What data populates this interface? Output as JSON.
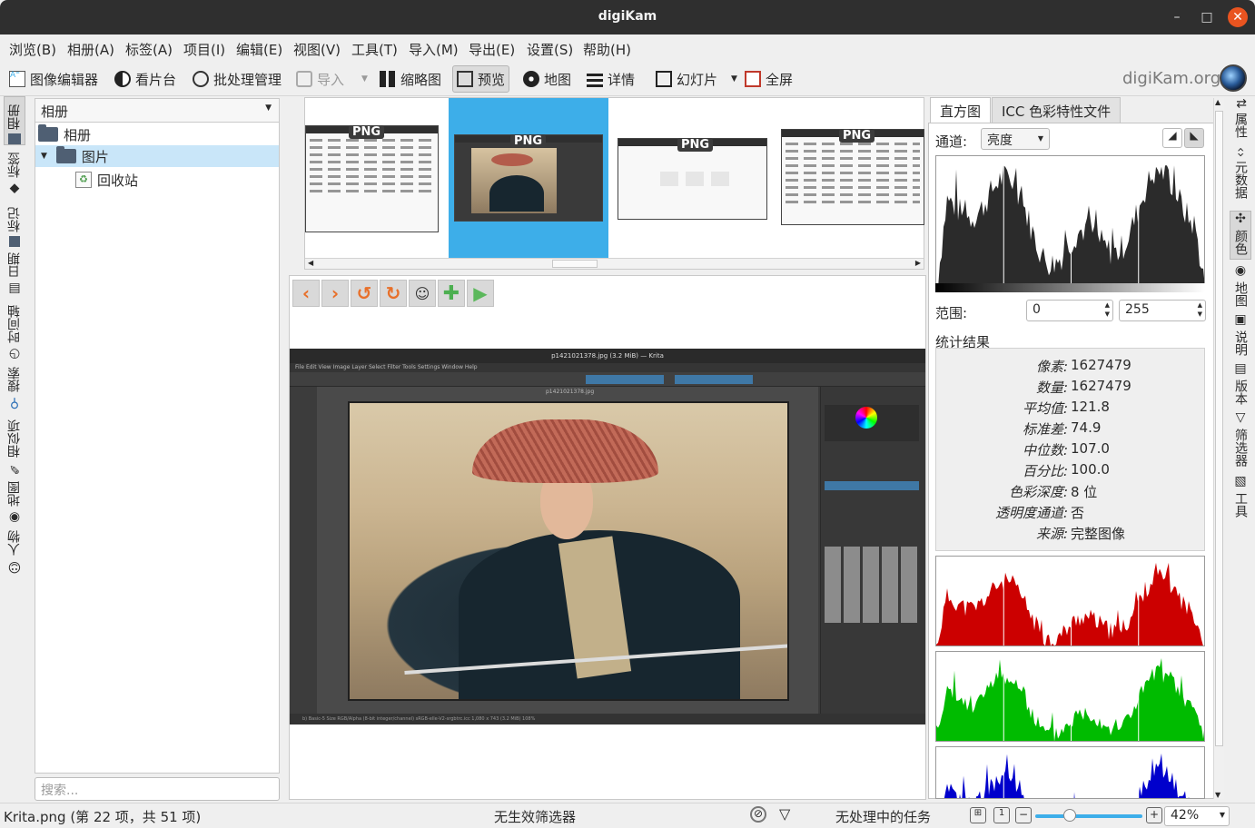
{
  "window": {
    "title": "digiKam",
    "min": "–",
    "max": "□",
    "close": "✕"
  },
  "menu": [
    "浏览(B)",
    "相册(A)",
    "标签(A)",
    "项目(I)",
    "编辑(E)",
    "视图(V)",
    "工具(T)",
    "导入(M)",
    "导出(E)",
    "设置(S)",
    "帮助(H)"
  ],
  "toolbar": {
    "image_editor": "图像编辑器",
    "light_table": "看片台",
    "batch_queue": "批处理管理",
    "import": "导入",
    "thumbnails": "缩略图",
    "preview": "预览",
    "map": "地图",
    "details": "详情",
    "slideshow": "幻灯片",
    "fullscreen": "全屏",
    "brand": "digiKam.org"
  },
  "left_tabs": [
    "相册",
    "标签",
    "标记",
    "日期",
    "时间轴",
    "搜索",
    "相似项",
    "地图",
    "人物"
  ],
  "album_panel": {
    "combo": "相册",
    "tree": [
      {
        "label": "相册",
        "level": 0
      },
      {
        "label": "图片",
        "level": 1,
        "selected": true
      },
      {
        "label": "回收站",
        "level": 2
      }
    ],
    "search_placeholder": "搜索..."
  },
  "thumbnails": [
    {
      "badge": "PNG",
      "selected": false
    },
    {
      "badge": "PNG",
      "selected": true
    },
    {
      "badge": "PNG",
      "selected": false
    },
    {
      "badge": "PNG",
      "selected": false
    }
  ],
  "preview_tools": [
    "back-icon",
    "forward-icon",
    "rotate-left-icon",
    "rotate-right-icon",
    "face-tag-icon",
    "add-to-light-table-icon",
    "play-icon"
  ],
  "krita": {
    "title": "p1421021378.jpg (3.2 MiB) — Krita",
    "menu": "File  Edit  View  Image  Layer  Select  Filter  Tools  Settings  Window  Help",
    "tab": "p1421021378.jpg",
    "status": "b) Basic-5 Size        RGB/Alpha (8-bit integer/channel)  sRGB-elle-V2-srgbtrc.icc        1,080 x 743 (3.2 MiB)        108%"
  },
  "right_panel": {
    "tab_histogram": "直方图",
    "tab_icc": "ICC 色彩特性文件",
    "channel_label": "通道:",
    "channel_value": "亮度",
    "range_label": "范围:",
    "range_min": "0",
    "range_max": "255",
    "stats_title": "统计结果",
    "stats": [
      {
        "label": "像素:",
        "value": "1627479"
      },
      {
        "label": "数量:",
        "value": "1627479"
      },
      {
        "label": "平均值:",
        "value": "121.8"
      },
      {
        "label": "标准差:",
        "value": "74.9"
      },
      {
        "label": "中位数:",
        "value": "107.0"
      },
      {
        "label": "百分比:",
        "value": "100.0"
      },
      {
        "label": "色彩深度:",
        "value": "8 位"
      },
      {
        "label": "透明度通道:",
        "value": "否"
      },
      {
        "label": "来源:",
        "value": "完整图像"
      }
    ],
    "colors": {
      "red": "#cc0000",
      "green": "#00bb00",
      "blue": "#0000cc",
      "luma": "#2b2b2b"
    }
  },
  "right_tabs": [
    "属性",
    "元数据",
    "颜色",
    "地图",
    "说明",
    "版本",
    "筛选器",
    "工具"
  ],
  "status": {
    "left": "Krita.png (第 22 项，共 51 项)",
    "filter": "无生效筛选器",
    "tasks": "无处理中的任务",
    "zoom": "42%",
    "zoom_fraction": 0.3
  }
}
